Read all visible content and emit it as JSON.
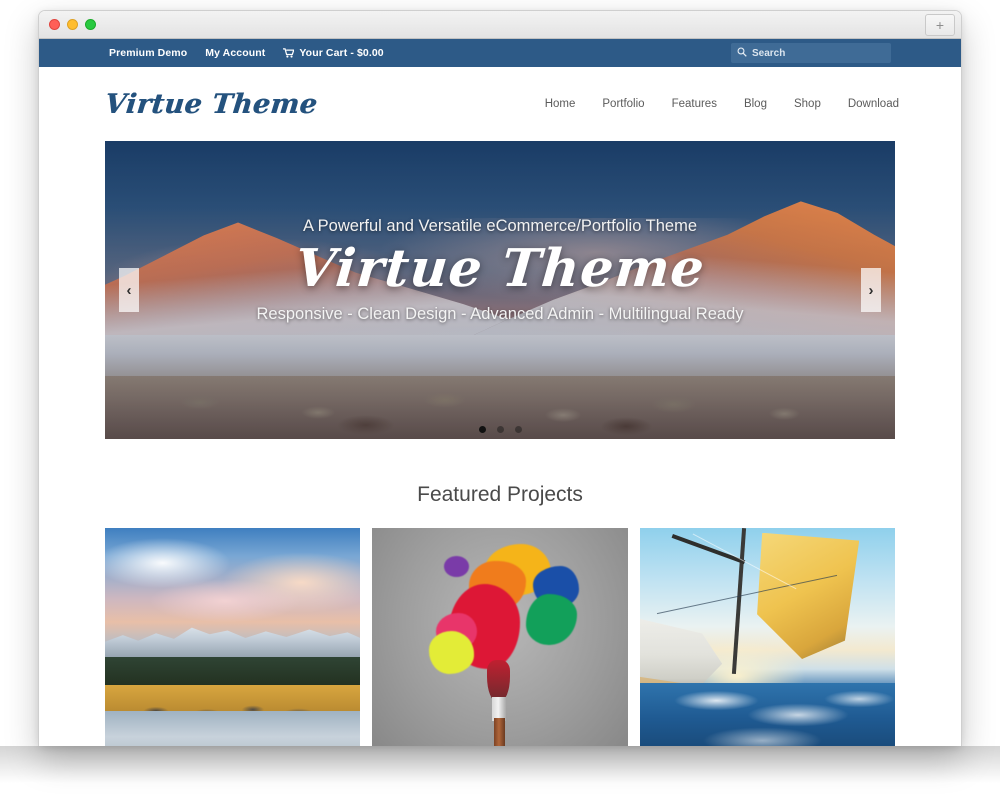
{
  "window": {
    "traffic_lights": [
      "close",
      "minimize",
      "zoom"
    ],
    "new_tab_label": "+"
  },
  "topbar": {
    "links": [
      {
        "label": "Premium Demo",
        "icon": null
      },
      {
        "label": "My Account",
        "icon": null
      },
      {
        "label": "Your Cart - $0.00",
        "icon": "cart-icon"
      }
    ],
    "background_color": "#2d5a87"
  },
  "search": {
    "placeholder": "Search",
    "value": "",
    "icon": "search-icon"
  },
  "header": {
    "logo": "Virtue Theme",
    "logo_color": "#24527e",
    "nav": [
      {
        "label": "Home"
      },
      {
        "label": "Portfolio"
      },
      {
        "label": "Features"
      },
      {
        "label": "Blog"
      },
      {
        "label": "Shop"
      },
      {
        "label": "Download"
      }
    ]
  },
  "hero": {
    "subtitle": "A Powerful and Versatile eCommerce/Portfolio Theme",
    "title": "Virtue Theme",
    "tagline": "Responsive - Clean Design - Advanced Admin - Multilingual Ready",
    "prev_label": "‹",
    "next_label": "›",
    "dots": [
      {
        "active": true
      },
      {
        "active": false
      },
      {
        "active": false
      }
    ],
    "image_description": "Snow-capped mountain range at sunrise with orange-lit peaks"
  },
  "featured": {
    "title": "Featured Projects",
    "projects": [
      {
        "name": "mountain-lake",
        "alt": "Mountain lake at sunset with snowy peaks"
      },
      {
        "name": "paint-splash",
        "alt": "Colorful paint splash exploding from a paintbrush"
      },
      {
        "name": "sailboat",
        "alt": "Sailboat with yellow sail cutting through ocean waves"
      }
    ]
  }
}
